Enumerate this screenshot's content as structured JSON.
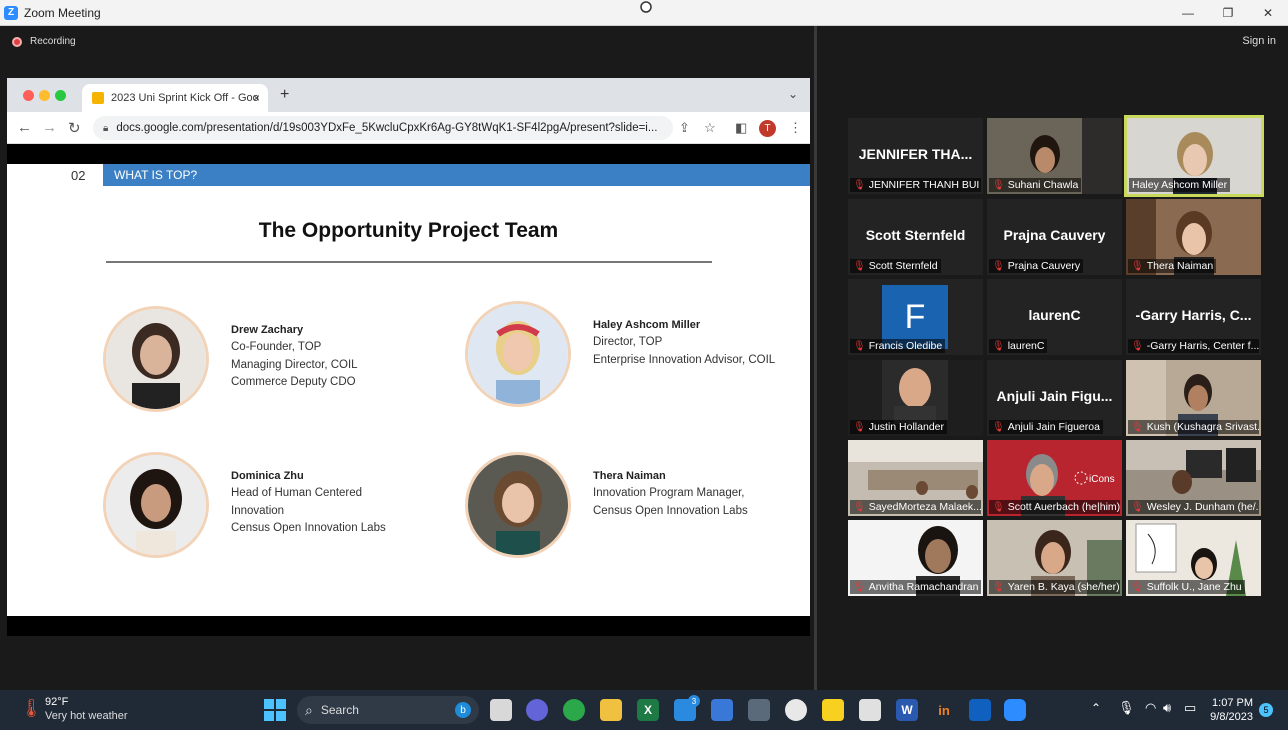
{
  "window": {
    "title": "Zoom Meeting",
    "minimize": "—",
    "restore": "❐",
    "close": "✕"
  },
  "meeting": {
    "recording_label": "Recording",
    "sign_in": "Sign in"
  },
  "browser": {
    "tab_title": "2023 Uni Sprint Kick Off - Goo",
    "tab_close": "×",
    "new_tab": "+",
    "url": "docs.google.com/presentation/d/19s003YDxFe_5KwcluCpxKr6Ag-GY8tWqK1-SF4l2pgA/present?slide=i...",
    "profile_initial": "T"
  },
  "slide": {
    "section_number": "02",
    "section_title": "WHAT IS TOP?",
    "title": "The Opportunity Project Team",
    "people": [
      {
        "name": "Drew Zachary",
        "lines": [
          "Co-Founder, TOP",
          "Managing Director, COIL",
          "Commerce Deputy CDO"
        ]
      },
      {
        "name": "Haley Ashcom Miller",
        "lines": [
          "Director, TOP",
          "Enterprise Innovation Advisor, COIL"
        ]
      },
      {
        "name": "Dominica Zhu",
        "lines": [
          "Head of Human Centered",
          "Innovation",
          "Census Open Innovation Labs"
        ]
      },
      {
        "name": "Thera Naiman",
        "lines": [
          "Innovation Program Manager,",
          "Census Open Innovation Labs"
        ]
      }
    ]
  },
  "participants": [
    {
      "label": "JENNIFER THANH BUI ...",
      "big": "JENNIFER THA..."
    },
    {
      "label": "Suhani Chawla",
      "big": ""
    },
    {
      "label": "Haley Ashcom Miller",
      "big": ""
    },
    {
      "label": "Scott Sternfeld",
      "big": "Scott Sternfeld"
    },
    {
      "label": "Prajna Cauvery",
      "big": "Prajna Cauvery"
    },
    {
      "label": "Thera Naiman",
      "big": ""
    },
    {
      "label": "Francis Oledibe",
      "big": "F"
    },
    {
      "label": "laurenC",
      "big": "laurenC"
    },
    {
      "label": "-Garry Harris, Center f...",
      "big": "-Garry Harris, C..."
    },
    {
      "label": "Justin Hollander",
      "big": ""
    },
    {
      "label": "Anjuli Jain Figueroa",
      "big": "Anjuli Jain Figu..."
    },
    {
      "label": "Kush (Kushagra Srivast...",
      "big": ""
    },
    {
      "label": "SayedMorteza Malaek...",
      "big": ""
    },
    {
      "label": "Scott Auerbach (he|him)",
      "big": ""
    },
    {
      "label": "Wesley J. Dunham (he/...",
      "big": ""
    },
    {
      "label": "Anvitha Ramachandran",
      "big": ""
    },
    {
      "label": "Yaren B. Kaya (she/her)",
      "big": ""
    },
    {
      "label": "Suffolk U., Jane Zhu",
      "big": ""
    }
  ],
  "scott_a_logo": "iCons",
  "taskbar": {
    "temp": "92°F",
    "weather": "Very hot weather",
    "search_placeholder": "Search",
    "mail_badge": "3",
    "time": "1:07 PM",
    "date": "9/8/2023",
    "notif_count": "5"
  }
}
